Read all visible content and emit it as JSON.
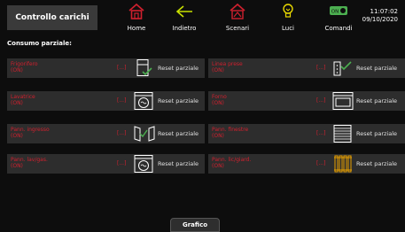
{
  "header": {
    "title": "Controllo carichi",
    "nav": [
      {
        "label": "Home",
        "icon": "home-icon"
      },
      {
        "label": "Indietro",
        "icon": "back-arrow-icon"
      },
      {
        "label": "Scenari",
        "icon": "scenarios-icon"
      },
      {
        "label": "Luci",
        "icon": "light-bulb-icon"
      },
      {
        "label": "Comandi",
        "icon": "toggle-switch-icon"
      }
    ],
    "comandi_toggle_text": "ON",
    "time": "11:07:02",
    "date": "09/10/2020"
  },
  "section_label": "Consumo parziale:",
  "loads": [
    {
      "name": "Frigorifero",
      "state": "(ON)",
      "value": "[...]",
      "icon": "fridge-icon",
      "reset_label": "Reset parziale"
    },
    {
      "name": "Linea prese",
      "state": "(ON)",
      "value": "[...]",
      "icon": "socket-line-icon",
      "reset_label": "Reset parziale"
    },
    {
      "name": "Lavatrice",
      "state": "(ON)",
      "value": "[...]",
      "icon": "washing-machine-icon",
      "reset_label": "Reset parziale"
    },
    {
      "name": "Forno",
      "state": "(ON)",
      "value": "[...]",
      "icon": "oven-icon",
      "reset_label": "Reset parziale"
    },
    {
      "name": "Pann. ingresso",
      "state": "(ON)",
      "value": "[...]",
      "icon": "entrance-door-icon",
      "reset_label": "Reset parziale"
    },
    {
      "name": "Pann. finestre",
      "state": "(ON)",
      "value": "[...]",
      "icon": "window-shutter-icon",
      "reset_label": "Reset parziale"
    },
    {
      "name": "Pann. lav/gas.",
      "state": "(ON)",
      "value": "[...]",
      "icon": "washing-machine-icon",
      "reset_label": "Reset parziale"
    },
    {
      "name": "Pann. lic/giard.",
      "state": "(ON)",
      "value": "[...]",
      "icon": "radiator-icon",
      "reset_label": "Reset parziale"
    }
  ],
  "footer": {
    "grafico_label": "Grafico"
  },
  "colors": {
    "accent_red": "#d0202e",
    "accent_green": "#4caf50",
    "accent_yellow": "#e8d800"
  }
}
